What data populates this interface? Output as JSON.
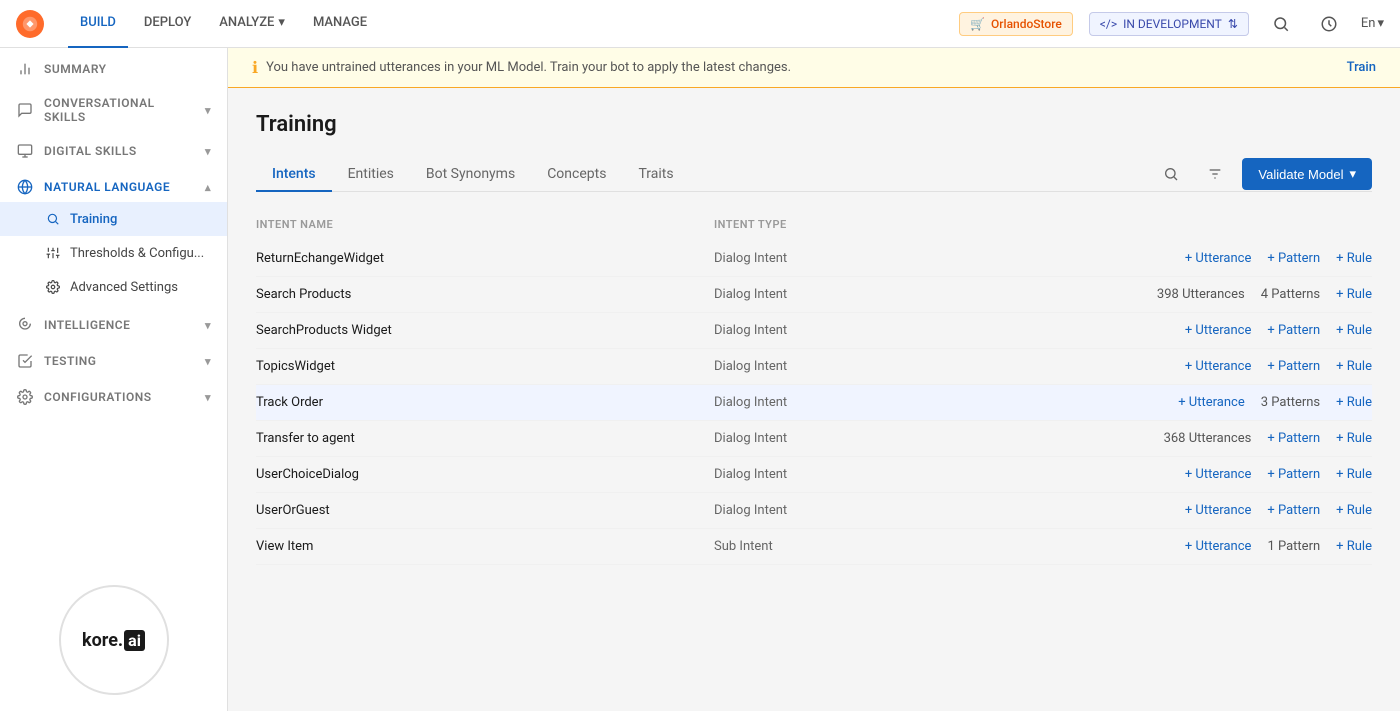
{
  "app": {
    "logo_alt": "Kore.ai",
    "nav_items": [
      {
        "label": "BUILD",
        "active": true
      },
      {
        "label": "DEPLOY",
        "active": false
      },
      {
        "label": "ANALYZE",
        "active": false,
        "has_dropdown": true
      },
      {
        "label": "MANAGE",
        "active": false
      }
    ],
    "store_name": "OrlandoStore",
    "env_label": "IN DEVELOPMENT",
    "lang": "En"
  },
  "sidebar": {
    "summary_label": "SUMMARY",
    "sections": [
      {
        "id": "conversational-skills",
        "label": "CONVERSATIONAL SKILLS",
        "expanded": true,
        "icon": "chat-icon"
      },
      {
        "id": "digital-skills",
        "label": "DIGITAL SKILLS",
        "expanded": true,
        "icon": "monitor-icon"
      },
      {
        "id": "natural-language",
        "label": "NATURAL LANGUAGE",
        "expanded": true,
        "icon": "language-icon",
        "children": [
          {
            "label": "Training",
            "active": true,
            "icon": "training-icon"
          },
          {
            "label": "Thresholds & Configu...",
            "active": false,
            "icon": "config-icon"
          },
          {
            "label": "Advanced Settings",
            "active": false,
            "icon": "settings-icon"
          }
        ]
      },
      {
        "id": "intelligence",
        "label": "INTELLIGENCE",
        "expanded": false,
        "icon": "intelligence-icon"
      },
      {
        "id": "testing",
        "label": "TESTING",
        "expanded": false,
        "icon": "testing-icon"
      },
      {
        "id": "configurations",
        "label": "CONFIGURATIONS",
        "expanded": false,
        "icon": "config-gear-icon"
      }
    ],
    "kore_logo_text": "kore.",
    "kore_logo_ai": "ai"
  },
  "notification": {
    "message": "You have untrained utterances in your ML Model. Train your bot to apply the latest changes.",
    "action_label": "Train"
  },
  "training": {
    "page_title": "Training",
    "tabs": [
      {
        "label": "Intents",
        "active": true
      },
      {
        "label": "Entities",
        "active": false
      },
      {
        "label": "Bot Synonyms",
        "active": false
      },
      {
        "label": "Concepts",
        "active": false
      },
      {
        "label": "Traits",
        "active": false
      }
    ],
    "validate_btn": "Validate Model",
    "columns": [
      {
        "label": "INTENT NAME"
      },
      {
        "label": "INTENT TYPE"
      },
      {
        "label": ""
      }
    ],
    "intents": [
      {
        "name": "ReturnEchangeWidget",
        "type": "Dialog Intent",
        "highlighted": false,
        "actions": [
          {
            "type": "link",
            "text": "+ Utterance"
          },
          {
            "type": "link",
            "text": "+ Pattern"
          },
          {
            "type": "link",
            "text": "+ Rule"
          }
        ]
      },
      {
        "name": "Search Products",
        "type": "Dialog Intent",
        "highlighted": false,
        "actions": [
          {
            "type": "count",
            "text": "398 Utterances"
          },
          {
            "type": "count",
            "text": "4 Patterns"
          },
          {
            "type": "link",
            "text": "+ Rule"
          }
        ]
      },
      {
        "name": "SearchProducts Widget",
        "type": "Dialog Intent",
        "highlighted": false,
        "actions": [
          {
            "type": "link",
            "text": "+ Utterance"
          },
          {
            "type": "link",
            "text": "+ Pattern"
          },
          {
            "type": "link",
            "text": "+ Rule"
          }
        ]
      },
      {
        "name": "TopicsWidget",
        "type": "Dialog Intent",
        "highlighted": false,
        "actions": [
          {
            "type": "link",
            "text": "+ Utterance"
          },
          {
            "type": "link",
            "text": "+ Pattern"
          },
          {
            "type": "link",
            "text": "+ Rule"
          }
        ]
      },
      {
        "name": "Track Order",
        "type": "Dialog Intent",
        "highlighted": true,
        "actions": [
          {
            "type": "link",
            "text": "+ Utterance"
          },
          {
            "type": "count",
            "text": "3 Patterns"
          },
          {
            "type": "link",
            "text": "+ Rule"
          }
        ]
      },
      {
        "name": "Transfer to agent",
        "type": "Dialog Intent",
        "highlighted": false,
        "actions": [
          {
            "type": "count",
            "text": "368 Utterances"
          },
          {
            "type": "link",
            "text": "+ Pattern"
          },
          {
            "type": "link",
            "text": "+ Rule"
          }
        ]
      },
      {
        "name": "UserChoiceDialog",
        "type": "Dialog Intent",
        "highlighted": false,
        "actions": [
          {
            "type": "link",
            "text": "+ Utterance"
          },
          {
            "type": "link",
            "text": "+ Pattern"
          },
          {
            "type": "link",
            "text": "+ Rule"
          }
        ]
      },
      {
        "name": "UserOrGuest",
        "type": "Dialog Intent",
        "highlighted": false,
        "actions": [
          {
            "type": "link",
            "text": "+ Utterance"
          },
          {
            "type": "link",
            "text": "+ Pattern"
          },
          {
            "type": "link",
            "text": "+ Rule"
          }
        ]
      },
      {
        "name": "View Item",
        "type": "Sub Intent",
        "highlighted": false,
        "actions": [
          {
            "type": "link",
            "text": "+ Utterance"
          },
          {
            "type": "count",
            "text": "1 Pattern"
          },
          {
            "type": "link",
            "text": "+ Rule"
          }
        ]
      }
    ]
  }
}
